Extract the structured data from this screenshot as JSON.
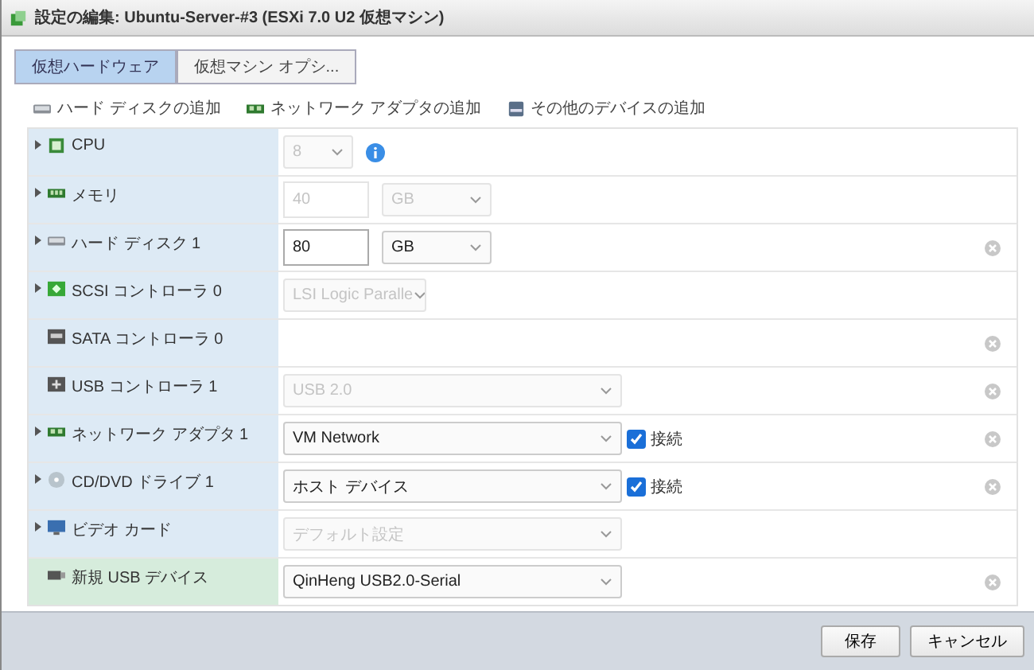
{
  "window": {
    "title": "設定の編集: Ubuntu-Server-#3 (ESXi 7.0 U2 仮想マシン)"
  },
  "tabs": [
    {
      "label": "仮想ハードウェア",
      "selected": true
    },
    {
      "label": "仮想マシン オプシ...",
      "selected": false
    }
  ],
  "toolbar": [
    {
      "kind": "disk",
      "label": "ハード ディスクの追加"
    },
    {
      "kind": "network",
      "label": "ネットワーク アダプタの追加"
    },
    {
      "kind": "device",
      "label": "その他のデバイスの追加"
    }
  ],
  "devices": [
    {
      "label": "CPU",
      "expandable": true,
      "removable": false,
      "highlighted": false,
      "controls": [
        {
          "kind": "select",
          "value": "8",
          "disabled": true
        },
        {
          "kind": "info"
        }
      ]
    },
    {
      "label": "メモリ",
      "expandable": true,
      "removable": false,
      "highlighted": false,
      "controls": [
        {
          "kind": "input",
          "value": "40",
          "disabled": true
        },
        {
          "kind": "select",
          "value": "GB",
          "disabled": true
        }
      ]
    },
    {
      "label": "ハード ディスク 1",
      "expandable": true,
      "removable": true,
      "highlighted": false,
      "controls": [
        {
          "kind": "input",
          "value": "80",
          "disabled": false
        },
        {
          "kind": "select",
          "value": "GB",
          "disabled": false
        }
      ]
    },
    {
      "label": "SCSI コントローラ 0",
      "expandable": true,
      "removable": false,
      "highlighted": false,
      "controls": [
        {
          "kind": "select",
          "value": "LSI Logic Paralle",
          "disabled": true
        }
      ]
    },
    {
      "label": "SATA コントローラ 0",
      "expandable": false,
      "removable": true,
      "highlighted": false
    },
    {
      "label": "USB コントローラ 1",
      "expandable": false,
      "removable": true,
      "highlighted": false,
      "controls": [
        {
          "kind": "select",
          "value": "USB 2.0",
          "disabled": true
        }
      ]
    },
    {
      "label": "ネットワーク アダプタ 1",
      "expandable": true,
      "removable": true,
      "highlighted": false,
      "controls": [
        {
          "kind": "select",
          "value": "VM Network",
          "disabled": false
        },
        {
          "kind": "checkbox",
          "label": "接続",
          "checked": true
        }
      ]
    },
    {
      "label": "CD/DVD ドライブ 1",
      "expandable": true,
      "removable": true,
      "highlighted": false,
      "controls": [
        {
          "kind": "select",
          "value": "ホスト デバイス",
          "disabled": false
        },
        {
          "kind": "checkbox",
          "label": "接続",
          "checked": true
        }
      ]
    },
    {
      "label": "ビデオ カード",
      "expandable": true,
      "removable": false,
      "highlighted": false,
      "controls": [
        {
          "kind": "select",
          "value": "デフォルト設定",
          "disabled": true
        }
      ]
    },
    {
      "label": "新規 USB デバイス",
      "expandable": false,
      "removable": true,
      "highlighted": true,
      "controls": [
        {
          "kind": "select",
          "value": "QinHeng USB2.0-Serial",
          "disabled": false
        }
      ]
    }
  ],
  "buttons": [
    "保存",
    "キャンセル"
  ]
}
